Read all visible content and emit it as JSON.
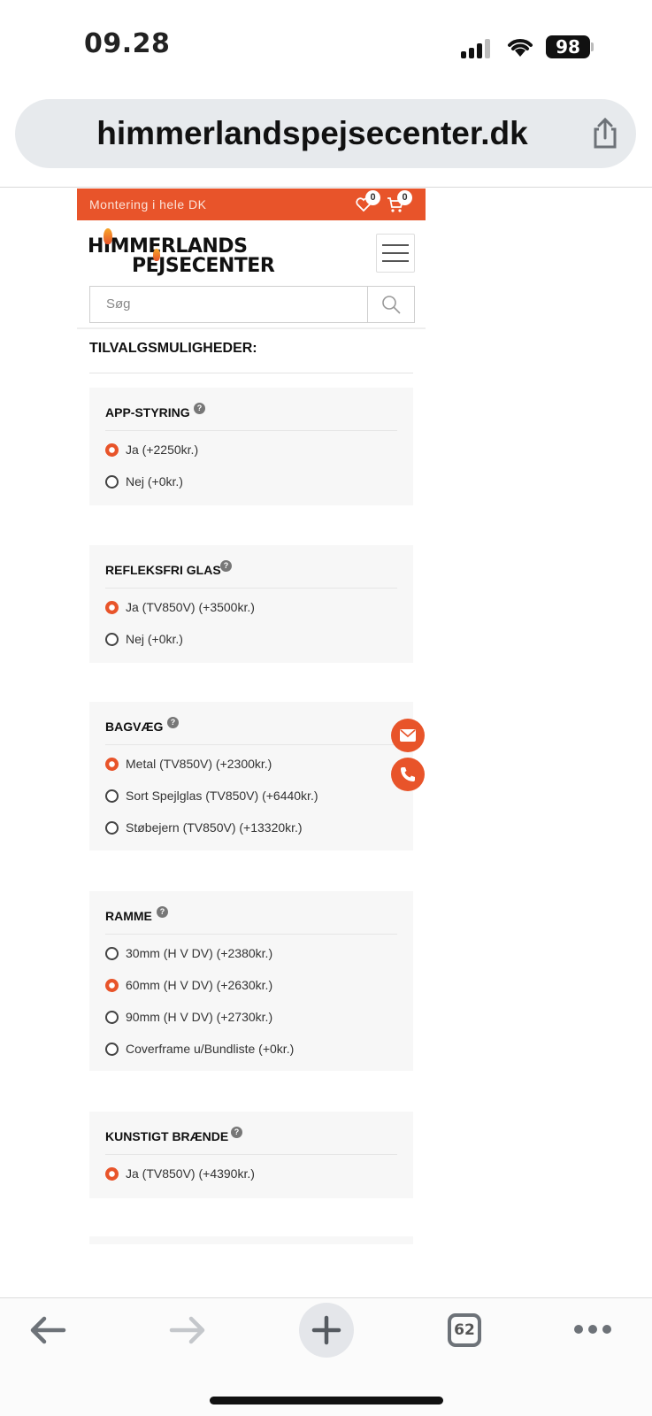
{
  "status": {
    "time": "09.28",
    "battery": "98"
  },
  "browser": {
    "url": "himmerlandspejsecenter.dk",
    "tab_count": "62"
  },
  "site": {
    "topbar_text": "Montering i hele DK",
    "wishlist_count": "0",
    "cart_count": "0",
    "logo_line1": "HIMMERLANDS",
    "logo_line2": "PEJSECENTER",
    "search_placeholder": "Søg",
    "accent": "#e8542a"
  },
  "options": {
    "title": "TILVALGSMULIGHEDER:",
    "groups": [
      {
        "title": "APP-STYRING",
        "help": "?",
        "items": [
          {
            "label": "Ja (+2250kr.)",
            "selected": true
          },
          {
            "label": "Nej (+0kr.)",
            "selected": false
          }
        ]
      },
      {
        "title": "REFLEKSFRI GLAS",
        "help": "?",
        "items": [
          {
            "label": "Ja (TV850V) (+3500kr.)",
            "selected": true
          },
          {
            "label": "Nej (+0kr.)",
            "selected": false
          }
        ]
      },
      {
        "title": "BAGVÆG",
        "help": "?",
        "items": [
          {
            "label": "Metal (TV850V) (+2300kr.)",
            "selected": true
          },
          {
            "label": "Sort Spejlglas (TV850V) (+6440kr.)",
            "selected": false
          },
          {
            "label": "Støbejern (TV850V) (+13320kr.)",
            "selected": false
          }
        ]
      },
      {
        "title": "RAMME",
        "help": "?",
        "items": [
          {
            "label": "30mm (H V DV) (+2380kr.)",
            "selected": false
          },
          {
            "label": "60mm (H V DV) (+2630kr.)",
            "selected": true
          },
          {
            "label": "90mm (H V DV) (+2730kr.)",
            "selected": false
          },
          {
            "label": "Coverframe u/Bundliste (+0kr.)",
            "selected": false
          }
        ]
      },
      {
        "title": "KUNSTIGT BRÆNDE",
        "help": "?",
        "items": [
          {
            "label": "Ja (TV850V) (+4390kr.)",
            "selected": true
          }
        ]
      }
    ]
  }
}
